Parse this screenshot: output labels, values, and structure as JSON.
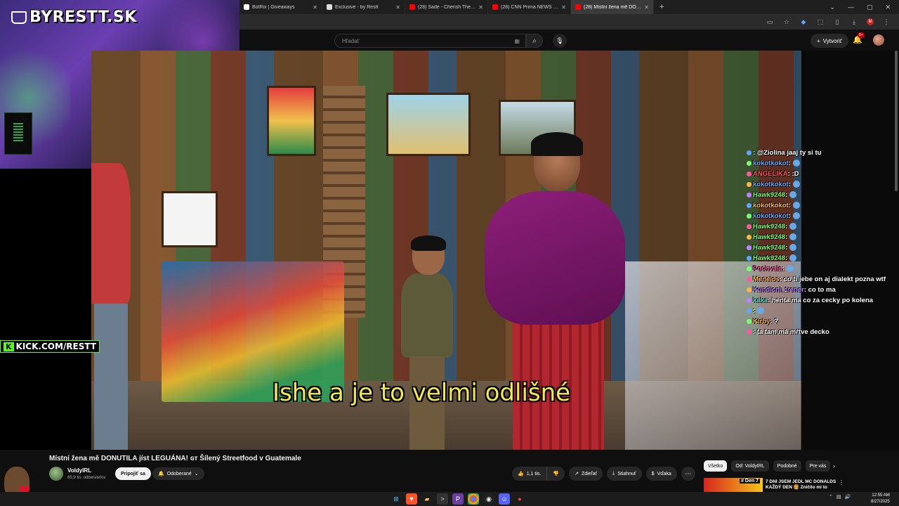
{
  "overlay": {
    "brand": "BYRESTT.SK",
    "kick": "KICK.COM/RESTT",
    "kick_k": "K"
  },
  "browser": {
    "tabs": [
      {
        "title": "BotRix | Giveaways",
        "color": "#ffffff",
        "active": false
      },
      {
        "title": "Exclusive - by Restt",
        "color": "#dddddd",
        "active": false
      },
      {
        "title": "(28) Sade - Cherish The Day - Y",
        "color": "#ff0000",
        "active": false
      },
      {
        "title": "(28) CNN Prima NEWS - YouTu",
        "color": "#ff0000",
        "active": false
      },
      {
        "title": "(28) Místní žena mě DONU",
        "color": "#ff0000",
        "active": true
      }
    ],
    "new_tab": "+",
    "profile_badge": "M"
  },
  "youtube": {
    "search_placeholder": "Hľadať",
    "create_label": "Vytvoriť",
    "notif_count": "9+",
    "video_title": "Místní žena mě DONUTILA jíst LEGUÁNA! ɢᴛ Šílený Streetfood v Guatemale",
    "channel_name": "VoldyIRL",
    "subscribers": "65,9 tis. odberateľov",
    "join_label": "Pripojiť sa",
    "subscribed_label": "Odoberané",
    "like_count": "1,1 tis.",
    "share_label": "Zdieľať",
    "download_label": "Stiahnuť",
    "thanks_label": "Vďaka",
    "chips": [
      "Všetko",
      "Od: VoldyIRL",
      "Podobné",
      "Pre vás"
    ],
    "rec_badge": "# Den 7",
    "rec_title": "7 DNÍ JSEM JEDL MC DONALDS KAŽDÝ DEN 🍔 Zničilo mi to"
  },
  "video": {
    "subtitle": "Ishe a je to velmi odlišné"
  },
  "chat": [
    {
      "user": "",
      "cls": "u-pink",
      "msg": "@Ziolina jaaj ty si tu"
    },
    {
      "user": "kokotkokot",
      "cls": "u-blue",
      "msg": ""
    },
    {
      "user": "ANGELIKA",
      "cls": "u-red",
      "msg": ":D"
    },
    {
      "user": "kokotkokot",
      "cls": "u-blue",
      "msg": ""
    },
    {
      "user": "Hawk9248",
      "cls": "u-green",
      "msg": ""
    },
    {
      "user": "kokotkokot",
      "cls": "u-orange",
      "msg": ""
    },
    {
      "user": "kokotkokot",
      "cls": "u-blue",
      "msg": ""
    },
    {
      "user": "Hawk9248",
      "cls": "u-green",
      "msg": ""
    },
    {
      "user": "Hawk9248",
      "cls": "u-green",
      "msg": ""
    },
    {
      "user": "Hawk9248",
      "cls": "u-green",
      "msg": ""
    },
    {
      "user": "Hawk9248",
      "cls": "u-green",
      "msg": ""
    },
    {
      "user": "Pochvala",
      "cls": "u-pink",
      "msg": ""
    },
    {
      "user": "Menelos",
      "cls": "u-orange",
      "msg": "co ti jebe on aj dialekt pozna wtf"
    },
    {
      "user": "Kundicni_trener",
      "cls": "u-purple",
      "msg": "co to ma"
    },
    {
      "user": "kaka",
      "cls": "u-teal",
      "msg": "henta ma co za cecky po kolena"
    },
    {
      "user": "",
      "cls": "u-pink",
      "msg": ""
    },
    {
      "user": "Kirby",
      "cls": "u-orange",
      "msg": "?"
    },
    {
      "user": "",
      "cls": "u-green",
      "msg": "ta tam má mŕtve decko"
    }
  ],
  "taskbar": {
    "time": "12:55 AM",
    "date": "8/27/2025"
  }
}
